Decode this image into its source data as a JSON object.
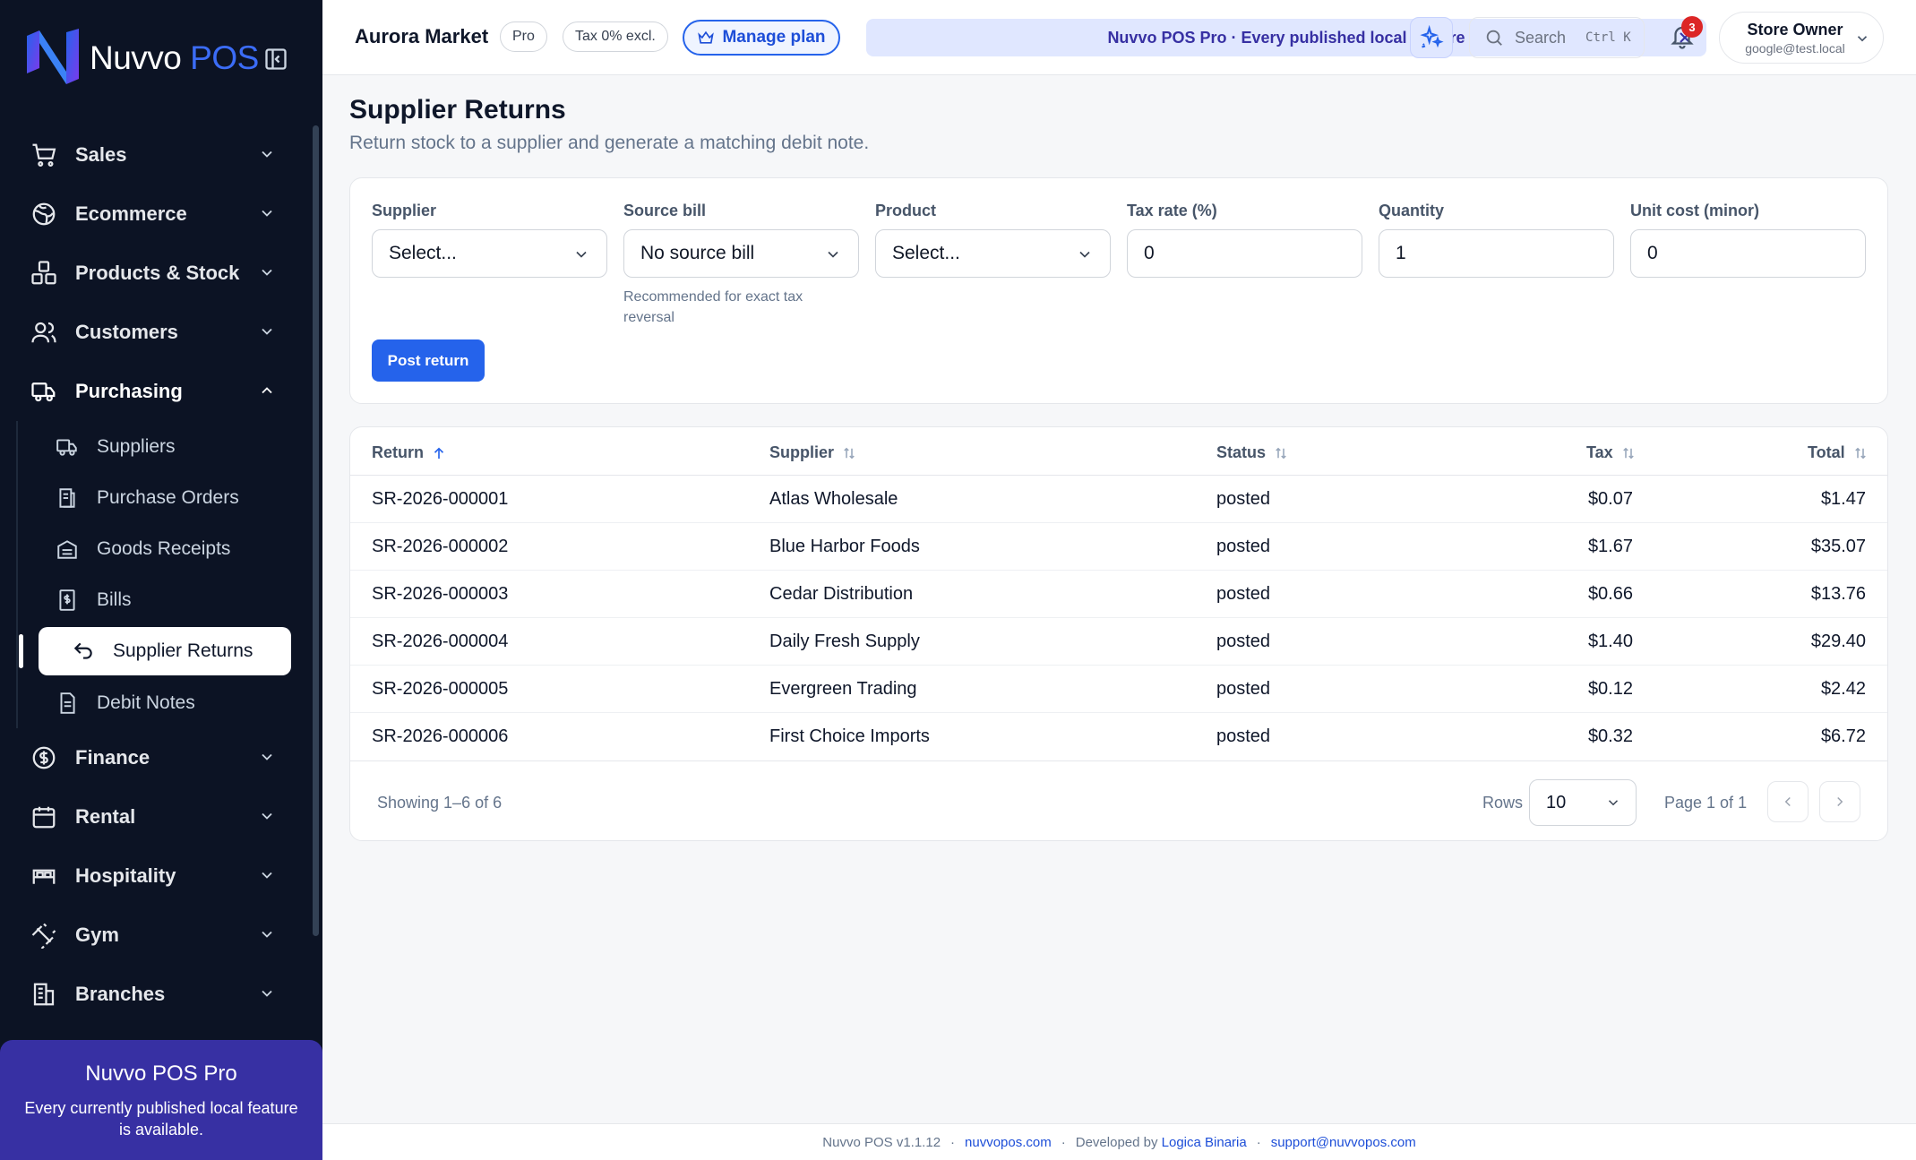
{
  "brand": {
    "name_white": "Nuvvo",
    "name_blue": "POS"
  },
  "sidebar": {
    "items": [
      {
        "label": "Sales",
        "icon": "cart-icon"
      },
      {
        "label": "Ecommerce",
        "icon": "globe-icon"
      },
      {
        "label": "Products & Stock",
        "icon": "boxes-icon"
      },
      {
        "label": "Customers",
        "icon": "users-icon"
      },
      {
        "label": "Purchasing",
        "icon": "truck-icon"
      }
    ],
    "purchasing_sub": [
      {
        "label": "Suppliers",
        "icon": "truck-icon"
      },
      {
        "label": "Purchase Orders",
        "icon": "clipboard-icon"
      },
      {
        "label": "Goods Receipts",
        "icon": "warehouse-icon"
      },
      {
        "label": "Bills",
        "icon": "bill-icon"
      },
      {
        "label": "Supplier Returns",
        "icon": "undo-icon"
      },
      {
        "label": "Debit Notes",
        "icon": "document-icon"
      }
    ],
    "items_after": [
      {
        "label": "Finance",
        "icon": "dollar-icon"
      },
      {
        "label": "Rental",
        "icon": "calendar-icon"
      },
      {
        "label": "Hospitality",
        "icon": "bed-icon"
      },
      {
        "label": "Gym",
        "icon": "dumbbell-icon"
      },
      {
        "label": "Branches",
        "icon": "building-icon"
      }
    ],
    "pro_card": {
      "title": "Nuvvo POS Pro",
      "desc": "Every currently published local feature is available."
    }
  },
  "topbar": {
    "store": "Aurora Market",
    "plan_badge": "Pro",
    "tax_badge": "Tax 0% excl.",
    "manage_plan": "Manage plan",
    "banner": "Nuvvo POS Pro · Every published local feature",
    "search_placeholder": "Search",
    "search_shortcut": "Ctrl K",
    "notifications": "3",
    "user_name": "Store Owner",
    "user_email": "google@test.local"
  },
  "page": {
    "title": "Supplier Returns",
    "subtitle": "Return stock to a supplier and generate a matching debit note."
  },
  "form": {
    "supplier": {
      "label": "Supplier",
      "value": "Select..."
    },
    "source_bill": {
      "label": "Source bill",
      "value": "No source bill",
      "hint": "Recommended for exact tax reversal"
    },
    "product": {
      "label": "Product",
      "value": "Select..."
    },
    "tax_rate": {
      "label": "Tax rate (%)",
      "value": "0"
    },
    "quantity": {
      "label": "Quantity",
      "value": "1"
    },
    "unit_cost": {
      "label": "Unit cost (minor)",
      "value": "0"
    },
    "submit": "Post return"
  },
  "table": {
    "headers": {
      "return": "Return",
      "supplier": "Supplier",
      "status": "Status",
      "tax": "Tax",
      "total": "Total"
    },
    "rows": [
      {
        "return": "SR-2026-000001",
        "supplier": "Atlas Wholesale",
        "status": "posted",
        "tax": "$0.07",
        "total": "$1.47"
      },
      {
        "return": "SR-2026-000002",
        "supplier": "Blue Harbor Foods",
        "status": "posted",
        "tax": "$1.67",
        "total": "$35.07"
      },
      {
        "return": "SR-2026-000003",
        "supplier": "Cedar Distribution",
        "status": "posted",
        "tax": "$0.66",
        "total": "$13.76"
      },
      {
        "return": "SR-2026-000004",
        "supplier": "Daily Fresh Supply",
        "status": "posted",
        "tax": "$1.40",
        "total": "$29.40"
      },
      {
        "return": "SR-2026-000005",
        "supplier": "Evergreen Trading",
        "status": "posted",
        "tax": "$0.12",
        "total": "$2.42"
      },
      {
        "return": "SR-2026-000006",
        "supplier": "First Choice Imports",
        "status": "posted",
        "tax": "$0.32",
        "total": "$6.72"
      }
    ],
    "showing": "Showing 1–6 of 6",
    "rows_label": "Rows",
    "rows_value": "10",
    "page_info": "Page 1 of 1"
  },
  "footer": {
    "version": "Nuvvo POS v1.1.12",
    "site": "nuvvopos.com",
    "dev_prefix": "Developed by",
    "dev": "Logica Binaria",
    "support": "support@nuvvopos.com"
  },
  "colors": {
    "sidebar_bg": "#0c1324",
    "accent": "#2563eb",
    "pro_card": "#3730a3",
    "banner_bg": "#e0e7ff"
  }
}
